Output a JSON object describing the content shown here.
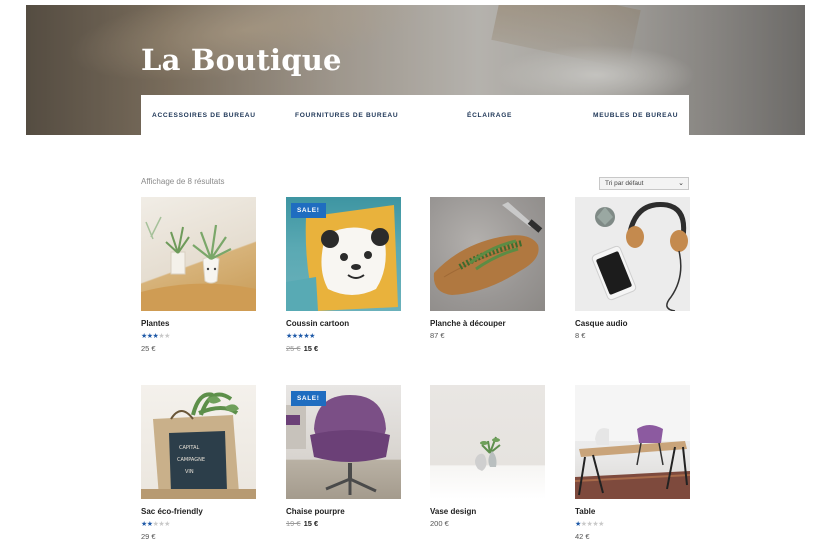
{
  "hero": {
    "title": "La Boutique"
  },
  "categories": [
    "ACCESSOIRES DE BUREAU",
    "FOURNITURES DE BUREAU",
    "ÉCLAIRAGE",
    "MEUBLES DE BUREAU"
  ],
  "toolbar": {
    "result_count": "Affichage de 8 résultats",
    "sort_selected": "Tri par défaut"
  },
  "sale_label": "SALE!",
  "products": [
    {
      "name": "Plantes",
      "rating": 3,
      "price": "25 €"
    },
    {
      "name": "Coussin cartoon",
      "rating": 5,
      "old_price": "25 €",
      "price": "15 €",
      "sale": true
    },
    {
      "name": "Planche à découper",
      "price": "87 €"
    },
    {
      "name": "Casque audio",
      "price": "8 €"
    },
    {
      "name": "Sac éco-friendly",
      "rating": 2,
      "price": "29 €"
    },
    {
      "name": "Chaise pourpre",
      "old_price": "19 €",
      "price": "15 €",
      "sale": true
    },
    {
      "name": "Vase design",
      "price": "200 €"
    },
    {
      "name": "Table",
      "rating": 1,
      "price": "42 €"
    }
  ],
  "colors": {
    "accent": "#1f6dc0",
    "star": "#1f5aa8",
    "nav_text": "#1d3556"
  }
}
